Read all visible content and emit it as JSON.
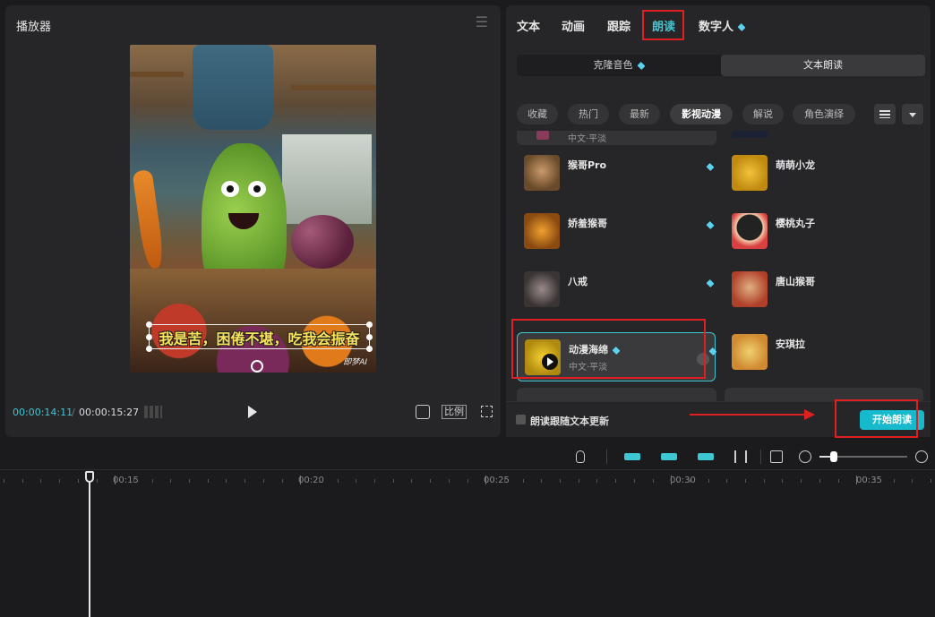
{
  "player": {
    "title": "播放器",
    "subtitle": "我是苦，困倦不堪，吃我会振奋",
    "watermark": "即梦AI",
    "time_current": "00:00:14:11",
    "time_separator": "/",
    "time_total": "00:00:15:27",
    "ratio_label": "比例"
  },
  "right_panel": {
    "tabs": [
      {
        "label": "文本"
      },
      {
        "label": "动画"
      },
      {
        "label": "跟踪"
      },
      {
        "label": "朗读"
      },
      {
        "label": "数字人"
      }
    ],
    "segments": {
      "clone": "克隆音色",
      "text_read": "文本朗读"
    },
    "filters": [
      "收藏",
      "热门",
      "最新",
      "影视动漫",
      "解说",
      "角色演绎"
    ],
    "partial_top_sub": "中文·平淡",
    "voices": [
      {
        "name": "猴哥Pro",
        "vip": true
      },
      {
        "name": "萌萌小龙",
        "vip": false
      },
      {
        "name": "娇羞猴哥",
        "vip": true
      },
      {
        "name": "樱桃丸子",
        "vip": false
      },
      {
        "name": "八戒",
        "vip": true
      },
      {
        "name": "唐山猴哥",
        "vip": false
      },
      {
        "name": "动漫海绵",
        "sub": "中文·平淡",
        "vip": true,
        "selected": true
      },
      {
        "name": "安琪拉",
        "vip": false
      }
    ],
    "follow_text_label": "朗读跟随文本更新",
    "start_button": "开始朗读"
  },
  "timeline": {
    "ticks": [
      "00:15",
      "00:20",
      "00:25",
      "00:30",
      "00:35"
    ]
  },
  "colors": {
    "accent": "#3fc6d3",
    "annotation": "#e02020",
    "start_button": "#17b9cc"
  }
}
